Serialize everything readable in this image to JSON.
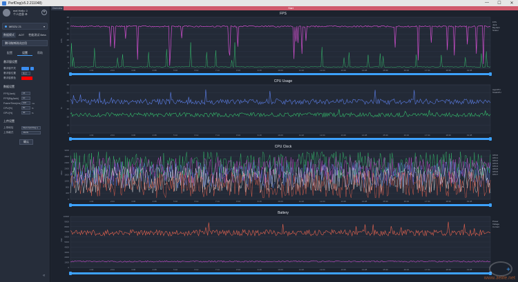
{
  "window": {
    "title": "PerfDog(v5.2.211048)",
    "controls": [
      "—",
      "☐",
      "✕"
    ]
  },
  "sidebar": {
    "user_name": "mel Hello ☺",
    "user_sub": "个人信息 ⚙",
    "device": "MEIZU 21",
    "top_tabs": [
      "数据模式",
      "AOT",
      "性能测试 Beta"
    ],
    "app_select": "腾讯微博测试应用",
    "tabs": [
      "配置",
      "设置",
      "帮助"
    ],
    "float_section": {
      "title": "悬浮窗设置",
      "rows": [
        {
          "label": "悬浮窗开关",
          "type": "toggle"
        },
        {
          "label": "悬浮窗位置",
          "value": "左上"
        },
        {
          "label": "悬浮窗颜色",
          "type": "color",
          "color": "#ff0000"
        }
      ]
    },
    "data_section": {
      "title": "数据设置",
      "rows": [
        {
          "label": "FPS(Jank)",
          "value": "15"
        },
        {
          "label": "FPS(BigJank)",
          "value": "10"
        },
        {
          "label": "FrameTime(ms)",
          "value": "100",
          "unit": "ms"
        },
        {
          "label": "CPU(%)",
          "value": "60",
          "unit": "%"
        },
        {
          "label": "GPU(%)",
          "value": "40",
          "unit": "%"
        }
      ]
    },
    "upload_section": {
      "title": "上传设置",
      "rows": [
        {
          "label": "上传地址",
          "value": "https://perfdog.q"
        },
        {
          "label": "上传格式",
          "value": "JSON"
        }
      ]
    },
    "confirm_button": "确认"
  },
  "topbar": {
    "overview": "Overview",
    "start": "Start"
  },
  "x_ticks": [
    "1:02",
    "2:04",
    "3:06",
    "4:08",
    "5:10",
    "6:12",
    "7:14",
    "8:16",
    "9:18",
    "10:20",
    "11:22",
    "12:24",
    "13:26",
    "14:28",
    "15:30",
    "16:32",
    "17:34",
    "18:36",
    "19:38"
  ],
  "panels": [
    {
      "title": "FPS",
      "ylabel": "FPS",
      "yticks": [
        "0",
        "5",
        "10",
        "15",
        "20",
        "25",
        "30",
        "35",
        "40",
        "45"
      ],
      "legend": [
        "FPS",
        "Jank",
        "BigJank",
        "Stutter"
      ]
    },
    {
      "title": "CPU Usage",
      "ylabel": "%",
      "yticks": [
        "0",
        "10",
        "20",
        "30",
        "40",
        "50",
        "60"
      ],
      "legend": [
        "AppCPU",
        "TotalCPU"
      ]
    },
    {
      "title": "CPU Clock",
      "ylabel": "MHz",
      "yticks": [
        "0",
        "400",
        "800",
        "1200",
        "1600",
        "2000",
        "2400",
        "2800",
        "3200"
      ],
      "legend": [
        "CPU0",
        "CPU1",
        "CPU2",
        "CPU3",
        "CPU4",
        "CPU5",
        "CPU6",
        "CPU7"
      ]
    },
    {
      "title": "Battery",
      "ylabel": "mW",
      "yticks": [
        "0",
        "1000",
        "2000",
        "3000",
        "4000",
        "5000",
        "6000",
        "7000",
        "8000",
        "9000",
        "10000"
      ],
      "legend": [
        "Power",
        "Voltage",
        "Current"
      ]
    }
  ],
  "colors": {
    "fps": "#d24fd0",
    "jank": "#35c06d",
    "cpu_total": "#5b7ee8",
    "cpu_app": "#35c06d",
    "battery": "#e8634f",
    "battery2": "#c84fd0",
    "accent": "#3da2ff"
  },
  "watermark": "www.3elife.net"
}
